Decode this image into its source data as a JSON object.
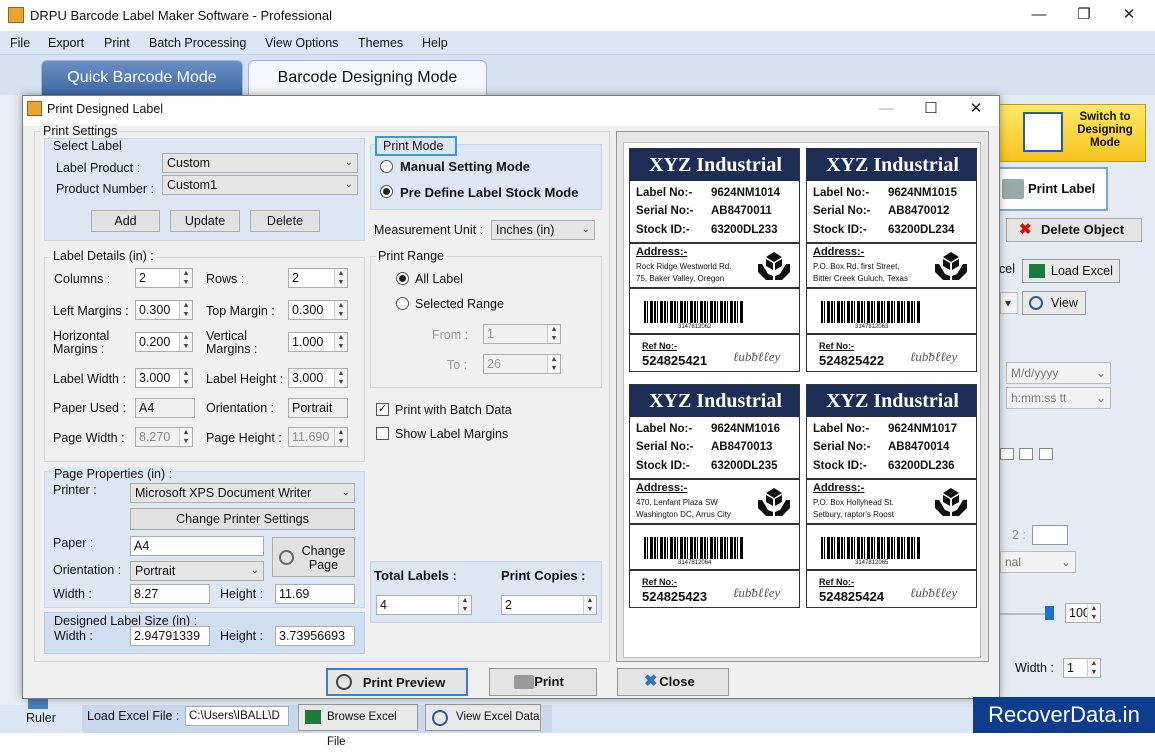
{
  "app": {
    "title": "DRPU Barcode Label Maker Software - Professional"
  },
  "menu": [
    "File",
    "Export",
    "Print",
    "Batch Processing",
    "View Options",
    "Themes",
    "Help"
  ],
  "modes": {
    "quick": "Quick Barcode Mode",
    "designing": "Barcode Designing Mode"
  },
  "right_panel": {
    "switch_label": "Switch to Designing Mode",
    "print_label": "Print Label",
    "delete_object": "Delete Object",
    "load_excel": "Load Excel",
    "view": "View",
    "date_format": "M/d/yyyy",
    "time_format": "h:mm:ss tt",
    "size_value": "100",
    "width_label": "Width :",
    "width_value": "1",
    "normal_partial": "nal",
    "excel_partial": "cel"
  },
  "bottom": {
    "ruler": "Ruler",
    "load_excel_file_label": "Load Excel File :",
    "path": "C:\\Users\\IBALL\\D",
    "browse_excel": "Browse Excel File",
    "view_excel": "View Excel Data"
  },
  "dialog": {
    "title": "Print Designed Label",
    "print_settings": "Print Settings",
    "select_label": {
      "title": "Select Label",
      "label_product_lbl": "Label Product :",
      "label_product_val": "Custom",
      "product_number_lbl": "Product Number :",
      "product_number_val": "Custom1",
      "add": "Add",
      "update": "Update",
      "delete": "Delete"
    },
    "label_details": {
      "title": "Label Details (in) :",
      "columns_lbl": "Columns :",
      "columns_val": "2",
      "rows_lbl": "Rows :",
      "rows_val": "2",
      "left_margins_lbl": "Left Margins :",
      "left_margins_val": "0.300",
      "top_margin_lbl": "Top Margin :",
      "top_margin_val": "0.300",
      "horizontal_margins_lbl": "Horizontal Margins :",
      "horizontal_margins_val": "0.200",
      "vertical_margins_lbl": "Vertical Margins :",
      "vertical_margins_val": "1.000",
      "label_width_lbl": "Label Width :",
      "label_width_val": "3.000",
      "label_height_lbl": "Label Height :",
      "label_height_val": "3.000",
      "paper_used_lbl": "Paper Used :",
      "paper_used_val": "A4",
      "orientation_lbl": "Orientation :",
      "orientation_val": "Portrait",
      "page_width_lbl": "Page Width :",
      "page_width_val": "8.270",
      "page_height_lbl": "Page Height :",
      "page_height_val": "11.690"
    },
    "page_properties": {
      "title": "Page Properties (in) :",
      "printer_lbl": "Printer :",
      "printer_val": "Microsoft XPS Document Writer",
      "change_printer": "Change Printer Settings",
      "paper_lbl": "Paper :",
      "paper_val": "A4",
      "change_page": "Change Page",
      "orientation_lbl": "Orientation :",
      "orientation_val": "Portrait",
      "width_lbl": "Width :",
      "width_val": "8.27",
      "height_lbl": "Height :",
      "height_val": "11.69"
    },
    "designed_size": {
      "title": "Designed Label Size (in) :",
      "width_lbl": "Width :",
      "width_val": "2.94791339",
      "height_lbl": "Height :",
      "height_val": "3.73956693"
    },
    "print_mode": {
      "title": "Print Mode",
      "manual": "Manual Setting Mode",
      "predefine": "Pre Define Label Stock Mode"
    },
    "measurement_lbl": "Measurement Unit :",
    "measurement_val": "Inches (in)",
    "print_range": {
      "title": "Print Range",
      "all": "All Label",
      "selected": "Selected Range",
      "from_lbl": "From :",
      "from_val": "1",
      "to_lbl": "To :",
      "to_val": "26"
    },
    "batch": "Print with Batch Data",
    "show_margins": "Show Label Margins",
    "total_labels_lbl": "Total Labels :",
    "total_labels_val": "4",
    "print_copies_lbl": "Print Copies :",
    "print_copies_val": "2",
    "buttons": {
      "preview": "Print Preview",
      "print": "Print",
      "close": "Close"
    }
  },
  "labels_common": {
    "company": "XYZ Industrial",
    "label_no": "Label No:-",
    "serial_no": "Serial No:-",
    "stock_id": "Stock ID:-",
    "address": "Address:-",
    "ref_no": "Ref No:-"
  },
  "labels": [
    {
      "label": "9624NM1014",
      "serial": "AB8470011",
      "stock": "63200DL233",
      "addr1": "Rock Ridge Westworld Rd.",
      "addr2": "75, Baker Valley, Oregon",
      "barcode": "3147812062",
      "ref": "524825421"
    },
    {
      "label": "9624NM1015",
      "serial": "AB8470012",
      "stock": "63200DL234",
      "addr1": "P.O. Box Rd. first Street,",
      "addr2": "Bitter Creek Guluch, Texas",
      "barcode": "3147812063",
      "ref": "524825422"
    },
    {
      "label": "9624NM1016",
      "serial": "AB8470013",
      "stock": "63200DL235",
      "addr1": "470, Lenfant Plaza SW",
      "addr2": "Washington DC, Arrus City",
      "barcode": "3147812064",
      "ref": "524825423"
    },
    {
      "label": "9624NM1017",
      "serial": "AB8470014",
      "stock": "63200DL236",
      "addr1": "P.O. Box Hollyhead St.",
      "addr2": "Setbury, raptor's Roost",
      "barcode": "3147812065",
      "ref": "524825424"
    }
  ],
  "watermark": "RecoverData.in"
}
